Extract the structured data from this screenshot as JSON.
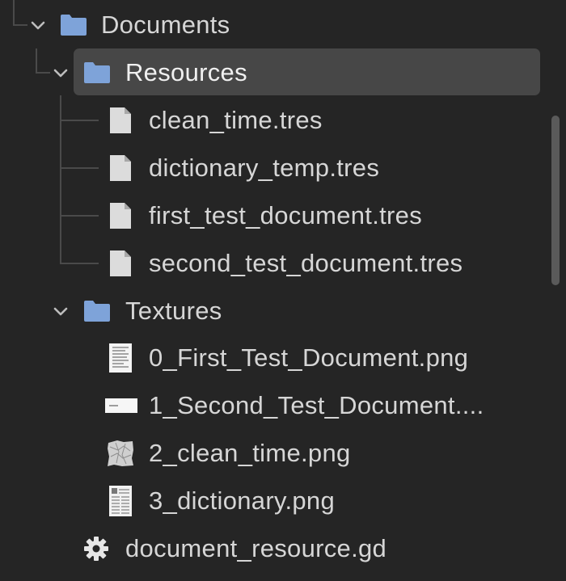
{
  "tree": {
    "items": [
      {
        "label": "Documents",
        "type": "folder",
        "expanded": true
      },
      {
        "label": "Resources",
        "type": "folder",
        "expanded": true,
        "selected": true
      },
      {
        "label": "clean_time.tres",
        "type": "file"
      },
      {
        "label": "dictionary_temp.tres",
        "type": "file"
      },
      {
        "label": "first_test_document.tres",
        "type": "file"
      },
      {
        "label": "second_test_document.tres",
        "type": "file"
      },
      {
        "label": "Textures",
        "type": "folder",
        "expanded": true
      },
      {
        "label": "0_First_Test_Document.png",
        "type": "image"
      },
      {
        "label": "1_Second_Test_Document....",
        "type": "image"
      },
      {
        "label": "2_clean_time.png",
        "type": "image"
      },
      {
        "label": "3_dictionary.png",
        "type": "image"
      },
      {
        "label": "document_resource.gd",
        "type": "script"
      }
    ]
  },
  "colors": {
    "background": "#252525",
    "selection": "#474747",
    "folder": "#7ea3d9",
    "text": "#d6d6d6",
    "guide": "#4a4a4a"
  }
}
